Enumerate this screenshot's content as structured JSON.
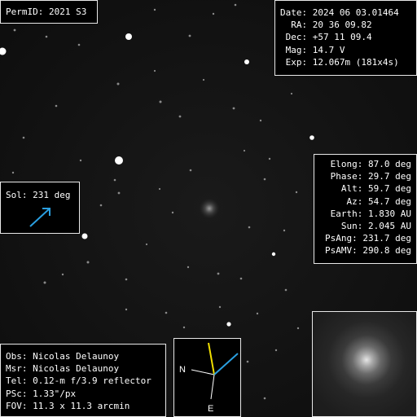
{
  "permid": {
    "label": "PermID:",
    "value": "2021 S3"
  },
  "observation": {
    "rows": [
      {
        "label": "Date:",
        "value": "2024 06 03.01464"
      },
      {
        "label": "RA:",
        "value": "20 36 09.82"
      },
      {
        "label": "Dec:",
        "value": "+57 11 09.4"
      },
      {
        "label": "Mag:",
        "value": "14.7 V"
      },
      {
        "label": "Exp:",
        "value": "12.067m (181x4s)"
      }
    ]
  },
  "geometry": {
    "rows": [
      {
        "label": "Elong:",
        "value": "87.0 deg"
      },
      {
        "label": "Phase:",
        "value": "29.7 deg"
      },
      {
        "label": "Alt:",
        "value": "59.7 deg"
      },
      {
        "label": "Az:",
        "value": "54.7 deg"
      },
      {
        "label": "Earth:",
        "value": "1.830 AU"
      },
      {
        "label": "Sun:",
        "value": "2.045 AU"
      },
      {
        "label": "PsAng:",
        "value": "231.7 deg"
      },
      {
        "label": "PsAMV:",
        "value": "290.8 deg"
      }
    ]
  },
  "sol": {
    "label": "Sol:",
    "value": "231 deg",
    "arrow_color": "#2a9fe0"
  },
  "equipment": {
    "rows": [
      {
        "label": "Obs:",
        "value": "Nicolas Delaunoy"
      },
      {
        "label": "Msr:",
        "value": "Nicolas Delaunoy"
      },
      {
        "label": "Tel:",
        "value": "0.12-m f/3.9 reflector"
      },
      {
        "label": "PSc:",
        "value": "1.33\"/px"
      },
      {
        "label": "FOV:",
        "value": "11.3 x 11.3 arcmin"
      }
    ]
  },
  "compass": {
    "north_label": "N",
    "east_label": "E",
    "sun_color": "#f2e000",
    "motion_color": "#2a9fe0"
  }
}
